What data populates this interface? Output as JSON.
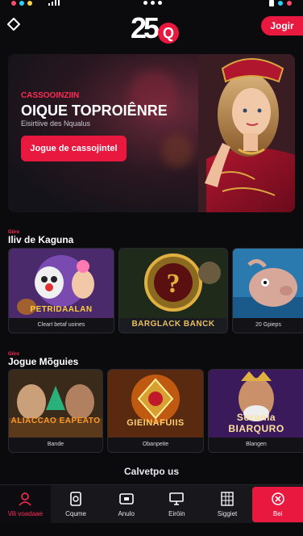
{
  "header": {
    "logo_text": "25",
    "logo_q": "Q",
    "login_label": "Jogir"
  },
  "hero": {
    "pretitle": "CASSOOINZIIN",
    "title": "OIQUE TOPROIÊNRE",
    "subtitle": "Eisirtiive des Nqualus",
    "cta_label": "Jogue de cassojintel"
  },
  "sections": {
    "s1_tag": "Giiro",
    "s1_title": "Iliv de Kaguna",
    "s2_tag": "Giiro",
    "s2_title": "Jogue Mõguies"
  },
  "row1": [
    {
      "title": "PETRIDAALAN",
      "caption": "Cleart betaf uoines"
    },
    {
      "title": "BARGLACK BANCK",
      "caption": ""
    },
    {
      "title": "",
      "caption": "20 Gpieps"
    }
  ],
  "row2": [
    {
      "title": "ALIACCAO EAPEATO",
      "caption": "Bande"
    },
    {
      "title": "GIEINAFUIIS",
      "caption": "Obanpeite"
    },
    {
      "title": "Soronia BIARQURO",
      "caption": "Blangen"
    }
  ],
  "footer_link": "Calvetpo us",
  "nav": [
    {
      "label": "Vili voadaae",
      "icon": "user-icon"
    },
    {
      "label": "Cqume",
      "icon": "safe-icon"
    },
    {
      "label": "Anulo",
      "icon": "wallet-icon"
    },
    {
      "label": "Eiröin",
      "icon": "monitor-icon"
    },
    {
      "label": "Siggiet",
      "icon": "grid-icon"
    },
    {
      "label": "Bei",
      "icon": "bet-icon"
    }
  ],
  "colors": {
    "accent": "#e8183f",
    "background": "#0b0b0e"
  }
}
